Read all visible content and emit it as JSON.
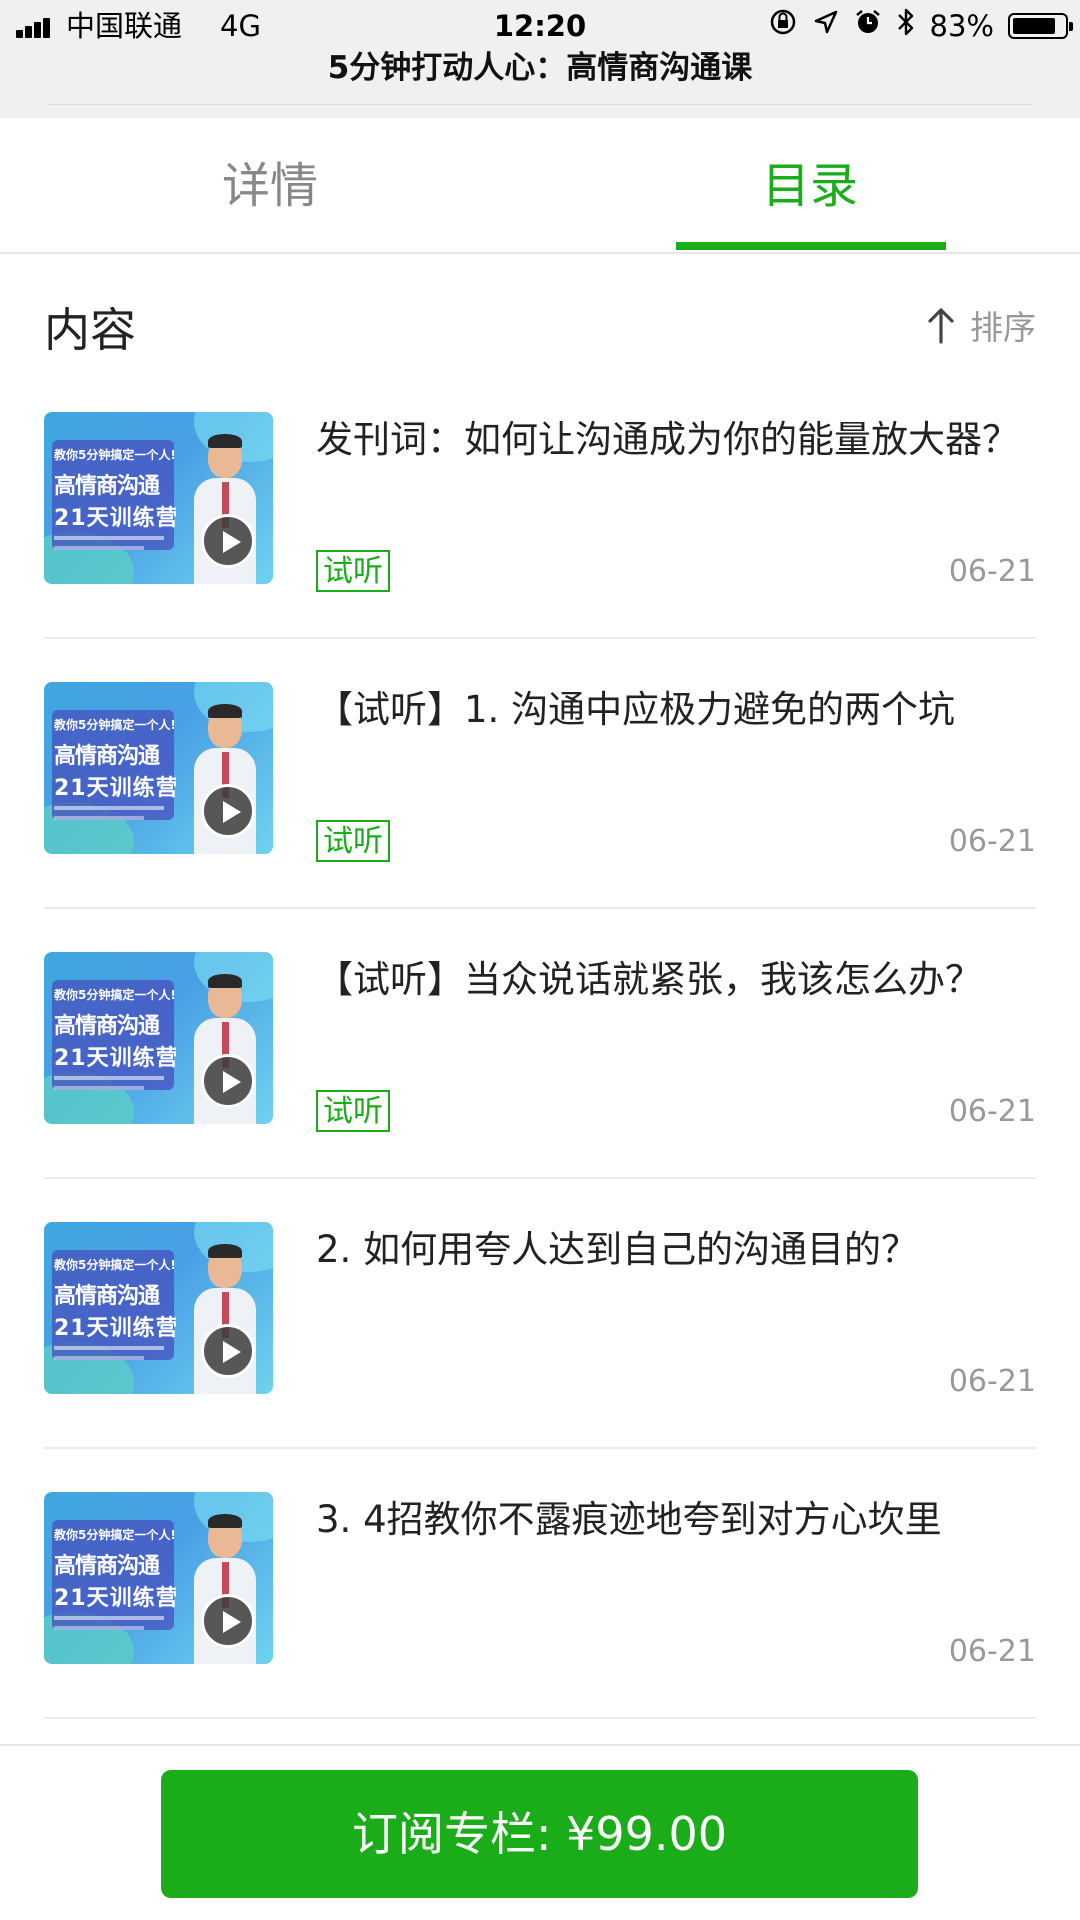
{
  "status_bar": {
    "carrier": "中国联通",
    "network": "4G",
    "time": "12:20",
    "battery": "83%",
    "battery_level": 0.83,
    "icons": [
      "orientation-lock-icon",
      "location-arrow-icon",
      "alarm-icon",
      "bluetooth-icon",
      "battery-icon"
    ]
  },
  "header": {
    "title": "5分钟打动人心：高情商沟通课"
  },
  "tabs": [
    {
      "label": "详情",
      "active": false
    },
    {
      "label": "目录",
      "active": true
    }
  ],
  "section": {
    "title": "内容",
    "sort_label": "排序"
  },
  "thumbnail": {
    "line1": "教你5分钟搞定一个人!",
    "line2": "高情商沟通",
    "line3": "21天训练营"
  },
  "items": [
    {
      "title": "发刊词：如何让沟通成为你的能量放大器？",
      "badge": "试听",
      "date": "06-21"
    },
    {
      "title": "【试听】1. 沟通中应极力避免的两个坑",
      "badge": "试听",
      "date": "06-21"
    },
    {
      "title": "【试听】当众说话就紧张，我该怎么办？",
      "badge": "试听",
      "date": "06-21"
    },
    {
      "title": "2. 如何用夸人达到自己的沟通目的？",
      "date": "06-21"
    },
    {
      "title": "3. 4招教你不露痕迹地夸到对方心坎里",
      "date": "06-21"
    }
  ],
  "bottom": {
    "subscribe_label": "订阅专栏: ¥99.00"
  },
  "colors": {
    "accent": "#1aad19",
    "muted_text": "#999999",
    "title_bar_bg": "#f0f0f0"
  }
}
